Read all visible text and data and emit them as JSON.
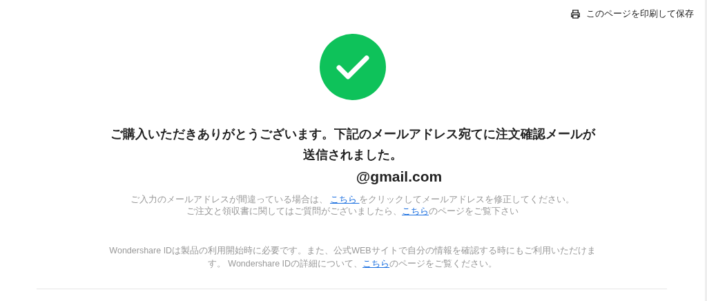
{
  "print_link": {
    "label": "このページを印刷して保存"
  },
  "status": {
    "kind": "success"
  },
  "heading": "ご購入いただきありがとうございます。下記のメールアドレス宛てに注文確認メールが送信されました。",
  "email": "@gmail.com",
  "notes": [
    {
      "parts": [
        {
          "kind": "text",
          "text": "ご入力のメールアドレスが間違っている場合は、 "
        },
        {
          "kind": "link",
          "text": "こちら "
        },
        {
          "kind": "text",
          "text": "をクリックしてメールアドレスを修正してください。"
        }
      ]
    },
    {
      "parts": [
        {
          "kind": "text",
          "text": "ご注文と領収書に関してはご質問がございましたら、"
        },
        {
          "kind": "link",
          "text": "こちら"
        },
        {
          "kind": "text",
          "text": "のページをご覧下さい"
        }
      ]
    }
  ],
  "info": {
    "parts": [
      {
        "kind": "text",
        "text": "Wondershare IDは製品の利用開始時に必要です。また、公式WEBサイトで自分の情報を確認する時にもご利用いただけます。 Wondershare IDの詳細について、"
      },
      {
        "kind": "link",
        "text": "こちら"
      },
      {
        "kind": "text",
        "text": "のページをご覧ください。"
      }
    ]
  }
}
